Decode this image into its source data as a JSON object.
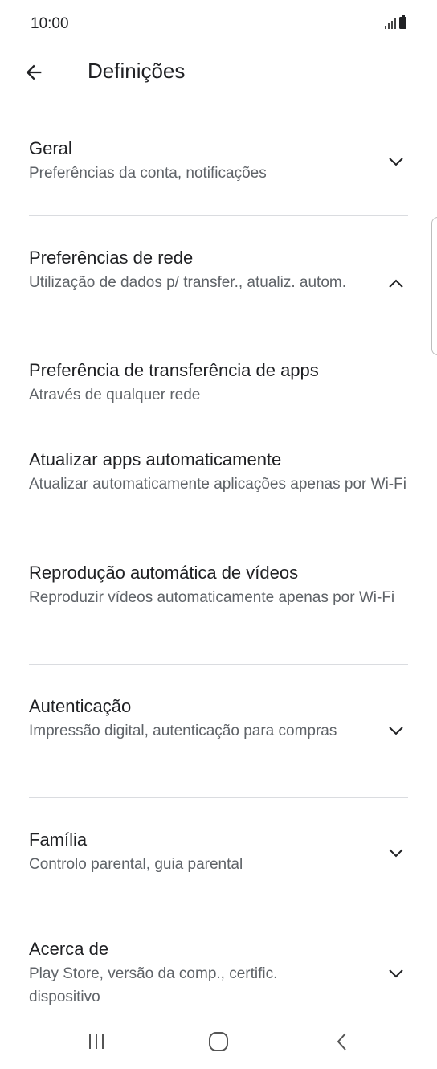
{
  "status_bar": {
    "time": "10:00"
  },
  "app_bar": {
    "title": "Definições"
  },
  "sections": {
    "general": {
      "title": "Geral",
      "subtitle": "Preferências da conta, notificações",
      "expanded": false
    },
    "network": {
      "title": "Preferências de rede",
      "subtitle": "Utilização de dados p/ transfer., atualiz. autom.",
      "expanded": true
    },
    "network_items": [
      {
        "title": "Preferência de transferência de apps",
        "subtitle": "Através de qualquer rede"
      },
      {
        "title": "Atualizar apps automaticamente",
        "subtitle": "Atualizar automaticamente aplicações apenas por Wi-Fi"
      },
      {
        "title": "Reprodução automática de vídeos",
        "subtitle": "Reproduzir vídeos automaticamente apenas por Wi-Fi"
      }
    ],
    "authentication": {
      "title": "Autenticação",
      "subtitle": "Impressão digital, autenticação para compras",
      "expanded": false
    },
    "family": {
      "title": "Família",
      "subtitle": "Controlo parental, guia parental",
      "expanded": false
    },
    "about": {
      "title": "Acerca de",
      "subtitle": "Play Store, versão da comp., certific. dispositivo",
      "expanded": false
    }
  },
  "icons": {
    "back": "arrow-back-icon",
    "expand": "chevron-down-icon",
    "collapse": "chevron-up-icon",
    "nav_recents": "recents-icon",
    "nav_home": "home-icon",
    "nav_back": "nav-back-icon"
  },
  "colors": {
    "text_primary": "#202124",
    "text_secondary": "#5f6368",
    "divider": "#dadce0"
  }
}
